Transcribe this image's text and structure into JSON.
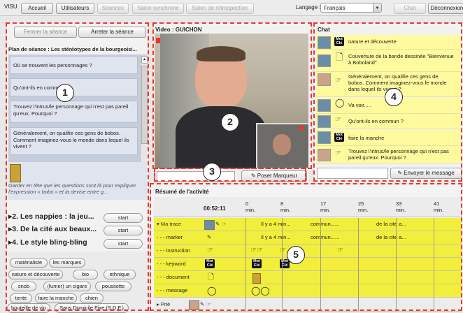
{
  "topbar": {
    "logo": "VISU",
    "tabs": [
      "Accueil",
      "Utilisateurs",
      "Séances",
      "Salon synchrone",
      "Salon de rétrospection"
    ],
    "language_label": "Langage :",
    "language_value": "Français",
    "chat_label": "Chat",
    "disconnect_label": "Déconnexion"
  },
  "left": {
    "close_session": "Fermer la séance",
    "stop_session": "Arreter la séance",
    "plan_title": "Plan de séance : Les stéréotypes de la bourgeoisi...",
    "questions": [
      "Où se trouvent les personnages ?",
      "Qu'ont-ils en commun ?",
      "Trouvez l'intrus/le personnage qui n'est pas pareil qu'eux. Pourquoi ?",
      "Généralement, on qualifie ces gens de bobos. Comment imaginez-vous le monde dans lequel ils vivent ?"
    ],
    "instruction_text": "Garder en tête que les questions sont là pour expliquer l'expression « bobo » et la devise entre g...",
    "sections": [
      {
        "title": "2. Les nappies : la jeu...",
        "button": "start"
      },
      {
        "title": "3. De la cité aux beaux...",
        "button": "start"
      },
      {
        "title": "4. Le style bling-bling",
        "button": "start"
      }
    ],
    "tags": [
      "matérialiste",
      "les marques",
      "nature et découverte",
      "bio",
      "ethnique",
      "snob",
      "(fumer) un cigare",
      "poussette",
      "tente",
      "faire la manche",
      "chien",
      "bouteille de vin",
      "Sans Domicile Fixe (S.D.F.)"
    ]
  },
  "video": {
    "title": "Video : GUICHON",
    "marker_button": "Poser Marqueur"
  },
  "chat": {
    "title": "Chat",
    "messages": [
      {
        "icon": "mot-cle",
        "text": "nature et découverte"
      },
      {
        "icon": "document",
        "text": "Couverture de la bande dessinée \"Bienvenue à Boboland\""
      },
      {
        "icon": "instruction",
        "text": "Généralement, on qualifie ces gens de bobos. Comment imaginez-vous le monde dans lequel ils vivent ?"
      },
      {
        "icon": "message",
        "text": "Va voir....."
      },
      {
        "icon": "instruction",
        "text": "Qu'ont-ils en commun ?"
      },
      {
        "icon": "mot-cle",
        "text": "faire la manche"
      },
      {
        "icon": "instruction",
        "text": "Trouvez l'intrus/le personnage qui n'est pas pareil qu'eux. Pourquoi ?"
      }
    ],
    "send_button": "Envoyer le message"
  },
  "activity": {
    "title": "Résumé de l'activité",
    "time": "00:52:11",
    "ticks": [
      {
        "num": "0",
        "unit": "min."
      },
      {
        "num": "8",
        "unit": "min."
      },
      {
        "num": "17",
        "unit": "min."
      },
      {
        "num": "25",
        "unit": "min."
      },
      {
        "num": "33",
        "unit": "min."
      },
      {
        "num": "41",
        "unit": "min."
      }
    ],
    "rows": [
      "Ma trace",
      "marker",
      "instruction",
      "keyword",
      "document",
      "message",
      "Prié"
    ],
    "trace_items": [
      "Il y a 4 min...",
      "commun......",
      "de la cité a..."
    ],
    "marker_items": [
      "Il y a 4 min...",
      "commun......",
      "de la cité a..."
    ]
  },
  "callouts": [
    "1",
    "2",
    "3",
    "4",
    "5"
  ],
  "mot_cle": "Mot Clé",
  "colors": {
    "callout": "#e8382d",
    "chat_yellow": "#fffa9e",
    "timeline_yellow": "#f2ef3c",
    "panel_blue": "#dfe4ef"
  }
}
